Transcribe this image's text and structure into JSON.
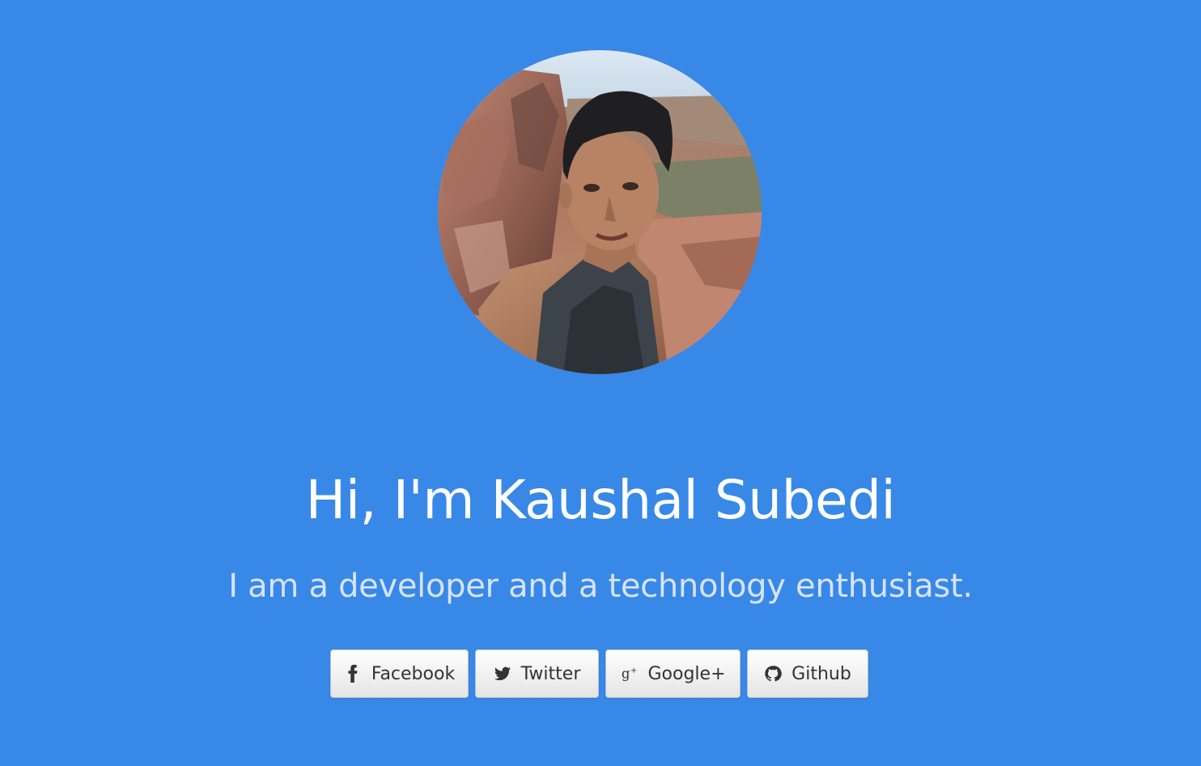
{
  "profile": {
    "heading": "Hi, I'm Kaushal Subedi",
    "tagline": "I am a developer and a technology enthusiast."
  },
  "social": {
    "facebook": {
      "label": "Facebook",
      "icon": "facebook-icon"
    },
    "twitter": {
      "label": "Twitter",
      "icon": "twitter-icon"
    },
    "google": {
      "label": "Google+",
      "icon": "google-plus-icon"
    },
    "github": {
      "label": "Github",
      "icon": "github-icon"
    }
  },
  "colors": {
    "background": "#3888e8",
    "heading": "#ffffff",
    "tagline": "#d6e3f6",
    "button_text": "#333333"
  }
}
